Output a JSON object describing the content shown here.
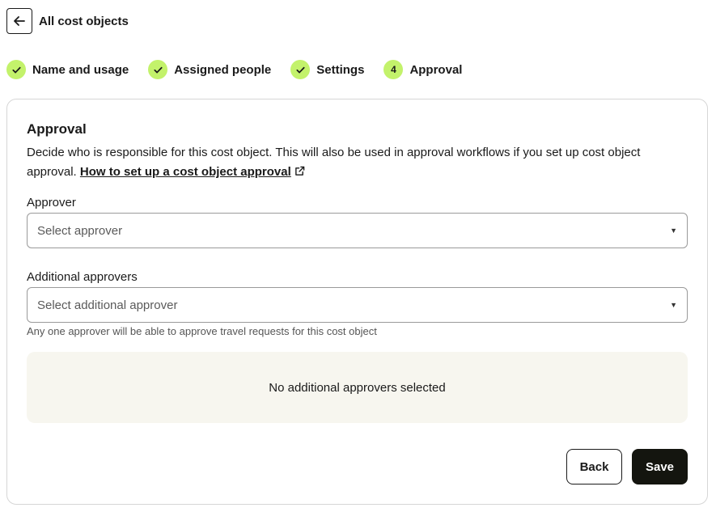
{
  "header": {
    "back_label": "All cost objects"
  },
  "steps": [
    {
      "marker": "check",
      "label": "Name and usage"
    },
    {
      "marker": "check",
      "label": "Assigned people"
    },
    {
      "marker": "check",
      "label": "Settings"
    },
    {
      "marker": "4",
      "label": "Approval"
    }
  ],
  "colors": {
    "accent": "#c3f26b",
    "primary_button": "#14150f",
    "empty_state_bg": "#f7f6ef"
  },
  "card": {
    "title": "Approval",
    "description": "Decide who is responsible for this cost object. This will also be used in approval workflows if you set up cost object approval.",
    "link_text": "How to set up a cost object approval",
    "approver_label": "Approver",
    "approver_placeholder": "Select approver",
    "additional_label": "Additional approvers",
    "additional_placeholder": "Select additional approver",
    "helper_text": "Any one approver will be able to approve travel requests for this cost object",
    "empty_state": "No additional approvers selected",
    "back_button": "Back",
    "save_button": "Save"
  }
}
